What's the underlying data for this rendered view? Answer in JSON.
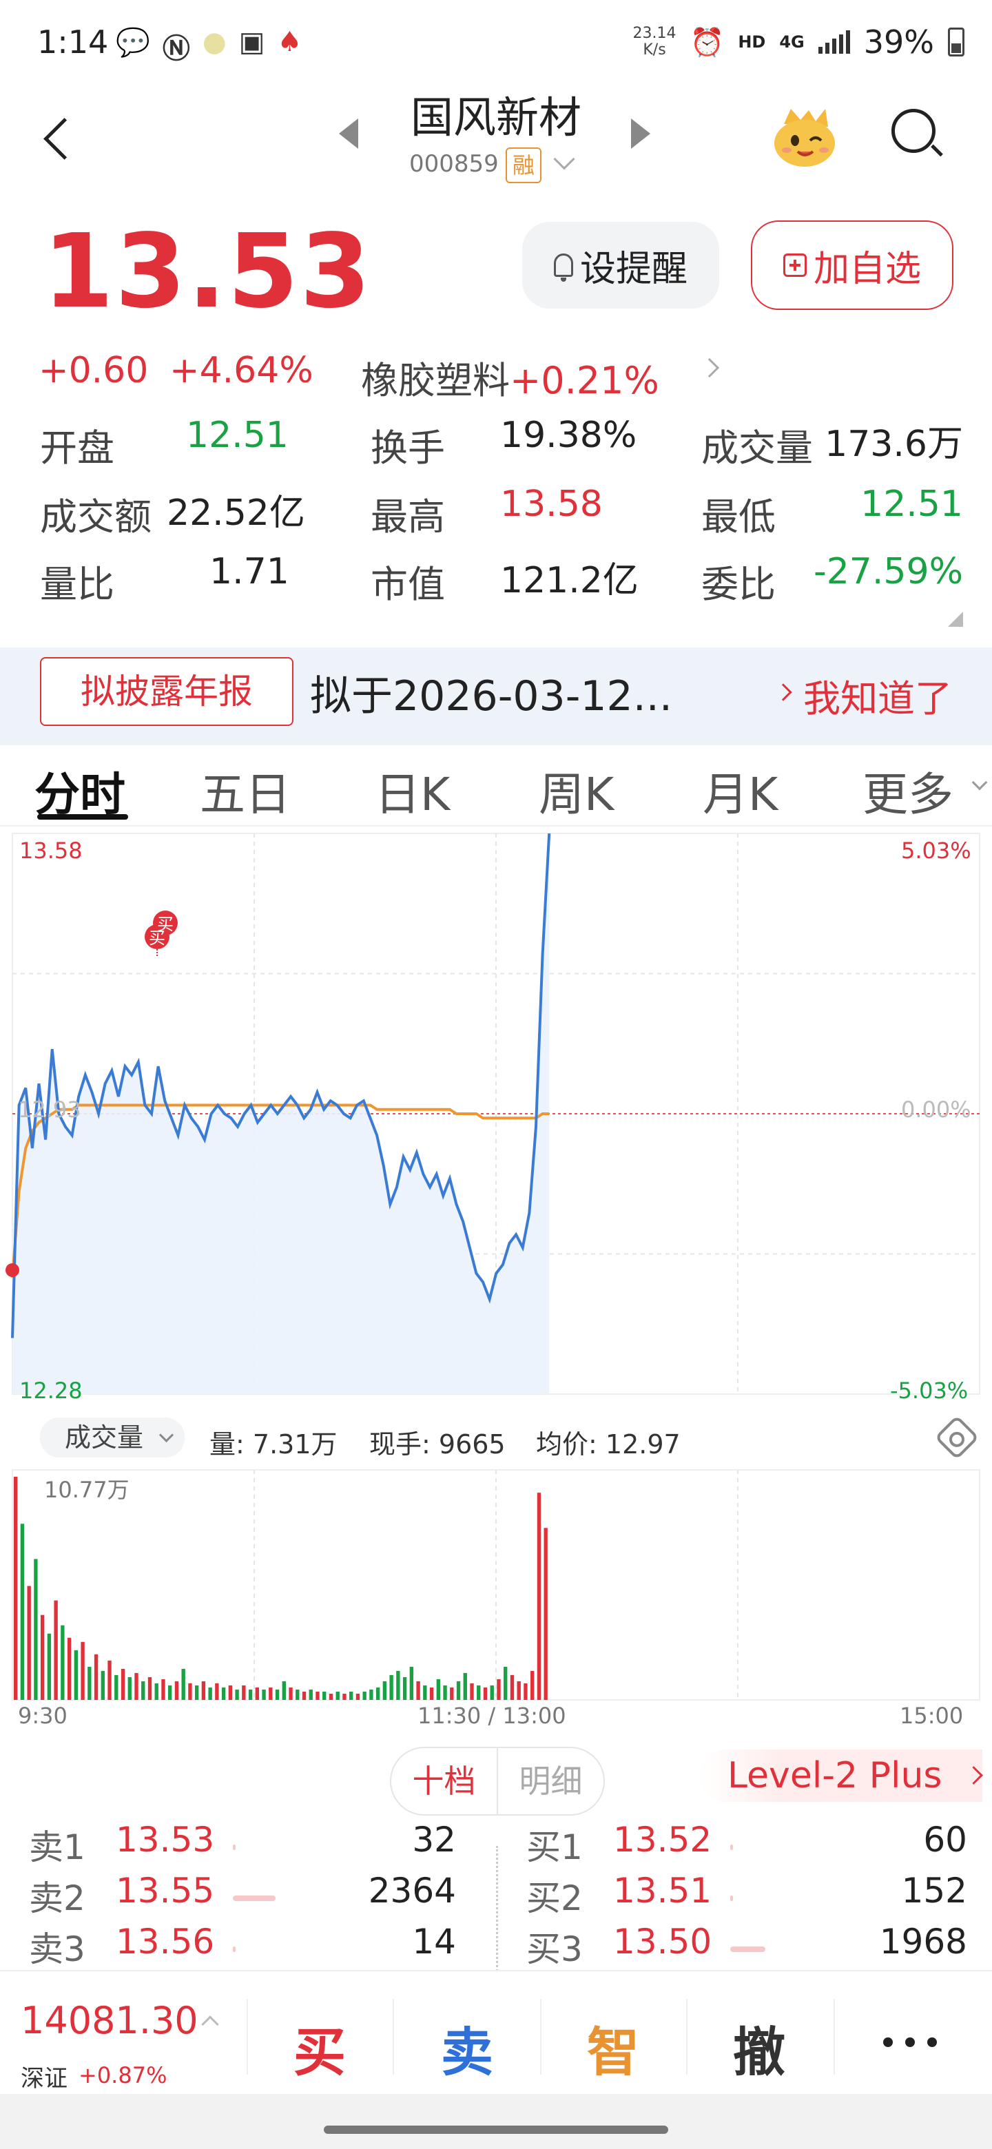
{
  "status_bar": {
    "time": "1:14",
    "net_speed_value": "23.14",
    "net_speed_unit": "K/s",
    "hd": "HD",
    "network": "4G",
    "battery": "39%",
    "icons": [
      "wechat-icon",
      "nfc-icon",
      "notification-icon",
      "gallery-icon",
      "cards-icon"
    ]
  },
  "header": {
    "stock_name": "国风新材",
    "stock_code": "000859",
    "margin_badge": "融"
  },
  "quote": {
    "price": "13.53",
    "change": "+0.60",
    "change_pct": "+4.64%",
    "sector_name": "橡胶塑料",
    "sector_change": "+0.21%",
    "alert_button": "设提醒",
    "favorite_button": "加自选"
  },
  "stats": [
    {
      "label": "开盘",
      "value": "12.51",
      "color": "down"
    },
    {
      "label": "换手",
      "value": "19.38%",
      "color": "neutral"
    },
    {
      "label": "成交量",
      "value": "173.6万",
      "color": "neutral"
    },
    {
      "label": "成交额",
      "value": "22.52亿",
      "color": "neutral"
    },
    {
      "label": "最高",
      "value": "13.58",
      "color": "up"
    },
    {
      "label": "最低",
      "value": "12.51",
      "color": "down"
    },
    {
      "label": "量比",
      "value": "1.71",
      "color": "neutral"
    },
    {
      "label": "市值",
      "value": "121.2亿",
      "color": "neutral"
    },
    {
      "label": "委比",
      "value": "-27.59%",
      "color": "down"
    }
  ],
  "notice": {
    "tag": "拟披露年报",
    "text": "拟于2026-03-12...",
    "dismiss": "我知道了"
  },
  "tabs": [
    "分时",
    "五日",
    "日K",
    "周K",
    "月K",
    "更多"
  ],
  "active_tab": "分时",
  "chart_data": {
    "type": "line",
    "title": "",
    "y_max_label": "13.58",
    "y_min_label": "12.28",
    "y_mid_label": "12.93",
    "pct_max_label": "5.03%",
    "pct_mid_label": "0.00%",
    "pct_min_label": "-5.03%",
    "ylim": [
      12.28,
      13.58
    ],
    "prev_close": 12.93,
    "x_ticks": [
      "9:30",
      "11:30 / 13:00",
      "15:00"
    ],
    "series": [
      {
        "name": "price",
        "color": "#3a7bd5",
        "values": [
          12.41,
          12.95,
          12.99,
          12.85,
          13.0,
          12.87,
          13.08,
          12.93,
          12.9,
          12.88,
          12.97,
          13.02,
          12.98,
          12.93,
          13.0,
          13.03,
          12.97,
          13.04,
          13.02,
          13.05,
          12.95,
          12.93,
          13.04,
          12.96,
          12.92,
          12.88,
          12.95,
          12.92,
          12.9,
          12.87,
          12.93,
          12.95,
          12.93,
          12.92,
          12.9,
          12.93,
          12.95,
          12.91,
          12.93,
          12.95,
          12.93,
          12.95,
          12.97,
          12.95,
          12.92,
          12.94,
          12.98,
          12.94,
          12.96,
          12.95,
          12.93,
          12.92,
          12.95,
          12.96,
          12.92,
          12.88,
          12.81,
          12.72,
          12.76,
          12.83,
          12.8,
          12.84,
          12.79,
          12.76,
          12.79,
          12.74,
          12.78,
          12.72,
          12.68,
          12.62,
          12.56,
          12.54,
          12.5,
          12.56,
          12.58,
          12.63,
          12.65,
          12.62,
          12.7,
          12.9,
          13.3,
          13.58
        ]
      },
      {
        "name": "avg",
        "color": "#f0962e",
        "values": [
          12.55,
          12.75,
          12.85,
          12.89,
          12.91,
          12.92,
          12.93,
          12.94,
          12.94,
          12.94,
          12.95,
          12.95,
          12.95,
          12.95,
          12.95,
          12.95,
          12.95,
          12.95,
          12.95,
          12.95,
          12.95,
          12.95,
          12.95,
          12.95,
          12.95,
          12.95,
          12.95,
          12.95,
          12.95,
          12.95,
          12.95,
          12.95,
          12.95,
          12.95,
          12.95,
          12.95,
          12.95,
          12.95,
          12.95,
          12.95,
          12.95,
          12.95,
          12.95,
          12.95,
          12.95,
          12.95,
          12.95,
          12.95,
          12.95,
          12.95,
          12.95,
          12.95,
          12.95,
          12.95,
          12.95,
          12.94,
          12.94,
          12.94,
          12.94,
          12.94,
          12.94,
          12.94,
          12.94,
          12.94,
          12.94,
          12.94,
          12.94,
          12.93,
          12.93,
          12.93,
          12.93,
          12.92,
          12.92,
          12.92,
          12.92,
          12.92,
          12.92,
          12.92,
          12.92,
          12.92,
          12.93,
          12.93
        ]
      }
    ],
    "trade_markers": [
      "买",
      "买"
    ]
  },
  "volume": {
    "selector": "成交量",
    "info": [
      {
        "label": "量:",
        "value": "7.31万"
      },
      {
        "label": "现手:",
        "value": "9665"
      },
      {
        "label": "均价:",
        "value": "12.97"
      }
    ],
    "max_label": "10.77万",
    "bars_max": 10.77,
    "bars": [
      {
        "v": 10.77,
        "c": "r"
      },
      {
        "v": 8.5,
        "c": "g"
      },
      {
        "v": 5.5,
        "c": "r"
      },
      {
        "v": 6.8,
        "c": "g"
      },
      {
        "v": 4.1,
        "c": "r"
      },
      {
        "v": 3.2,
        "c": "g"
      },
      {
        "v": 4.8,
        "c": "r"
      },
      {
        "v": 3.6,
        "c": "g"
      },
      {
        "v": 3.0,
        "c": "r"
      },
      {
        "v": 2.4,
        "c": "g"
      },
      {
        "v": 2.8,
        "c": "r"
      },
      {
        "v": 1.6,
        "c": "g"
      },
      {
        "v": 2.2,
        "c": "r"
      },
      {
        "v": 1.4,
        "c": "g"
      },
      {
        "v": 1.9,
        "c": "r"
      },
      {
        "v": 1.2,
        "c": "g"
      },
      {
        "v": 1.5,
        "c": "r"
      },
      {
        "v": 1.1,
        "c": "g"
      },
      {
        "v": 1.3,
        "c": "r"
      },
      {
        "v": 0.9,
        "c": "g"
      },
      {
        "v": 1.1,
        "c": "r"
      },
      {
        "v": 0.8,
        "c": "g"
      },
      {
        "v": 1.0,
        "c": "r"
      },
      {
        "v": 0.7,
        "c": "g"
      },
      {
        "v": 0.9,
        "c": "r"
      },
      {
        "v": 1.5,
        "c": "g"
      },
      {
        "v": 0.8,
        "c": "r"
      },
      {
        "v": 0.7,
        "c": "g"
      },
      {
        "v": 0.9,
        "c": "r"
      },
      {
        "v": 0.6,
        "c": "g"
      },
      {
        "v": 0.8,
        "c": "r"
      },
      {
        "v": 0.6,
        "c": "g"
      },
      {
        "v": 0.7,
        "c": "r"
      },
      {
        "v": 0.5,
        "c": "g"
      },
      {
        "v": 0.7,
        "c": "r"
      },
      {
        "v": 0.5,
        "c": "g"
      },
      {
        "v": 0.6,
        "c": "r"
      },
      {
        "v": 0.5,
        "c": "g"
      },
      {
        "v": 0.6,
        "c": "r"
      },
      {
        "v": 0.5,
        "c": "g"
      },
      {
        "v": 0.9,
        "c": "g"
      },
      {
        "v": 0.6,
        "c": "r"
      },
      {
        "v": 0.5,
        "c": "g"
      },
      {
        "v": 0.4,
        "c": "r"
      },
      {
        "v": 0.5,
        "c": "g"
      },
      {
        "v": 0.4,
        "c": "r"
      },
      {
        "v": 0.4,
        "c": "g"
      },
      {
        "v": 0.3,
        "c": "r"
      },
      {
        "v": 0.4,
        "c": "g"
      },
      {
        "v": 0.3,
        "c": "r"
      },
      {
        "v": 0.4,
        "c": "g"
      },
      {
        "v": 0.3,
        "c": "r"
      },
      {
        "v": 0.4,
        "c": "g"
      },
      {
        "v": 0.5,
        "c": "g"
      },
      {
        "v": 0.6,
        "c": "g"
      },
      {
        "v": 0.9,
        "c": "g"
      },
      {
        "v": 1.2,
        "c": "g"
      },
      {
        "v": 1.4,
        "c": "g"
      },
      {
        "v": 1.1,
        "c": "g"
      },
      {
        "v": 1.6,
        "c": "g"
      },
      {
        "v": 0.9,
        "c": "r"
      },
      {
        "v": 0.7,
        "c": "g"
      },
      {
        "v": 0.6,
        "c": "r"
      },
      {
        "v": 1.0,
        "c": "g"
      },
      {
        "v": 0.7,
        "c": "g"
      },
      {
        "v": 0.6,
        "c": "r"
      },
      {
        "v": 0.9,
        "c": "g"
      },
      {
        "v": 1.3,
        "c": "g"
      },
      {
        "v": 0.8,
        "c": "r"
      },
      {
        "v": 0.7,
        "c": "g"
      },
      {
        "v": 0.6,
        "c": "r"
      },
      {
        "v": 0.7,
        "c": "g"
      },
      {
        "v": 1.0,
        "c": "r"
      },
      {
        "v": 1.6,
        "c": "g"
      },
      {
        "v": 1.2,
        "c": "r"
      },
      {
        "v": 0.9,
        "c": "r"
      },
      {
        "v": 0.8,
        "c": "r"
      },
      {
        "v": 1.4,
        "c": "r"
      },
      {
        "v": 10.0,
        "c": "r"
      },
      {
        "v": 8.3,
        "c": "r"
      }
    ]
  },
  "order_book": {
    "tab_active": "十档",
    "tab_other": "明细",
    "level2": "Level-2 Plus",
    "asks": [
      {
        "name": "卖1",
        "price": "13.53",
        "qty": "32",
        "bar": 0.01
      },
      {
        "name": "卖2",
        "price": "13.55",
        "qty": "2364",
        "bar": 1.0
      },
      {
        "name": "卖3",
        "price": "13.56",
        "qty": "14",
        "bar": 0.01
      }
    ],
    "bids": [
      {
        "name": "买1",
        "price": "13.52",
        "qty": "60",
        "bar": 0.02
      },
      {
        "name": "买2",
        "price": "13.51",
        "qty": "152",
        "bar": 0.05
      },
      {
        "name": "买3",
        "price": "13.50",
        "qty": "1968",
        "bar": 0.83
      }
    ]
  },
  "bottom_bar": {
    "index_value": "14081.30",
    "index_name": "深证",
    "index_change": "+0.87%",
    "buy": "买",
    "sell": "卖",
    "smart": "智",
    "cancel": "撤",
    "colors": {
      "buy": "#e0303a",
      "sell": "#2e6fd8",
      "smart": "#e8932f",
      "cancel": "#333333"
    }
  }
}
